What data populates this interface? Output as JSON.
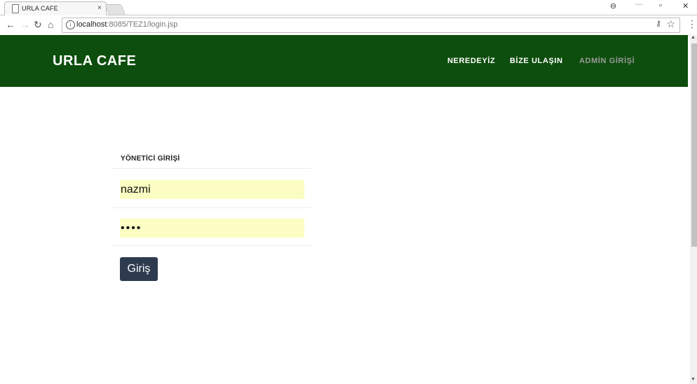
{
  "browser": {
    "tab_title": "URLA CAFE",
    "tab_close": "×",
    "url_host": "localhost",
    "url_rest": ":8085/TEZ1/login.jsp",
    "window_controls": {
      "min": "—",
      "max": "▫",
      "close": "✕",
      "account": "⊖"
    }
  },
  "site": {
    "brand": "URLA CAFE",
    "nav": [
      {
        "label": "NEREDEYİZ"
      },
      {
        "label": "BİZE ULAŞIN"
      },
      {
        "label": "ADMİN GİRİŞİ"
      }
    ]
  },
  "login": {
    "title": "YÖNETİCİ GİRİŞİ",
    "username_value": "nazmi",
    "password_value": "••••",
    "submit_label": "Giriş"
  },
  "colors": {
    "header_bg": "#0d4d0d",
    "autofill_bg": "#fbfdc2",
    "button_bg": "#2e3b4f",
    "active_nav": "#9a9a9a"
  }
}
